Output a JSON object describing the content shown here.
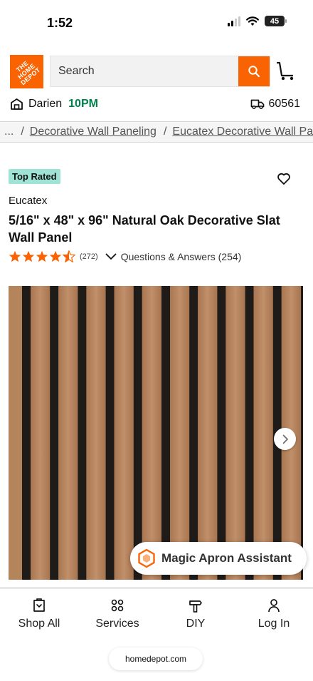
{
  "status_bar": {
    "time": "1:52",
    "battery": "45"
  },
  "header": {
    "logo_text": "THE HOME DEPOT",
    "search_placeholder": "Search"
  },
  "store": {
    "name": "Darien",
    "hours": "10PM",
    "zip": "60561"
  },
  "breadcrumb": {
    "ellipsis": "...",
    "items": [
      "Decorative Wall Paneling",
      "Eucatex Decorative Wall Pan"
    ]
  },
  "product": {
    "badge": "Top Rated",
    "brand": "Eucatex",
    "title": "5/16\" x 48\" x 96\" Natural Oak Decorative Slat Wall Panel",
    "rating": 4.5,
    "review_count": "(272)",
    "qa_label": "Questions & Answers (254)"
  },
  "assistant": {
    "label": "Magic Apron Assistant"
  },
  "bottom_nav": [
    {
      "label": "Shop All",
      "icon": "shop-all-icon"
    },
    {
      "label": "Services",
      "icon": "services-icon"
    },
    {
      "label": "DIY",
      "icon": "diy-icon"
    },
    {
      "label": "Log In",
      "icon": "user-icon"
    }
  ],
  "browser": {
    "url": "homedepot.com"
  },
  "colors": {
    "brand_orange": "#f96302",
    "store_hours_green": "#00804a",
    "badge_teal": "#9ee3d6",
    "star_orange": "#f96302"
  }
}
